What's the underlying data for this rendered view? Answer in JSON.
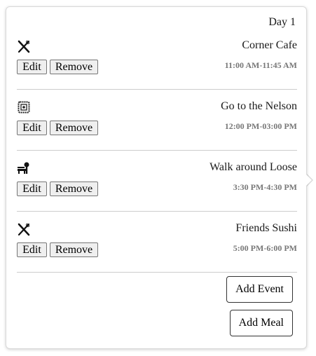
{
  "day": {
    "title": "Day 1"
  },
  "events": [
    {
      "icon": "fork-knife-icon",
      "name": "Corner Cafe",
      "time": "11:00 AM-11:45 AM",
      "edit_label": "Edit",
      "remove_label": "Remove"
    },
    {
      "icon": "museum-frame-icon",
      "name": "Go to the Nelson",
      "time": "12:00 PM-03:00 PM",
      "edit_label": "Edit",
      "remove_label": "Remove"
    },
    {
      "icon": "park-bench-icon",
      "name": "Walk around Loose",
      "time": "3:30 PM-4:30 PM",
      "edit_label": "Edit",
      "remove_label": "Remove"
    },
    {
      "icon": "fork-knife-icon",
      "name": "Friends Sushi",
      "time": "5:00 PM-6:00 PM",
      "edit_label": "Edit",
      "remove_label": "Remove"
    }
  ],
  "actions": {
    "add_event_label": "Add Event",
    "add_meal_label": "Add Meal"
  },
  "colors": {
    "time_text": "#777777",
    "divider": "#cccccc",
    "border": "#d9d9d9"
  }
}
